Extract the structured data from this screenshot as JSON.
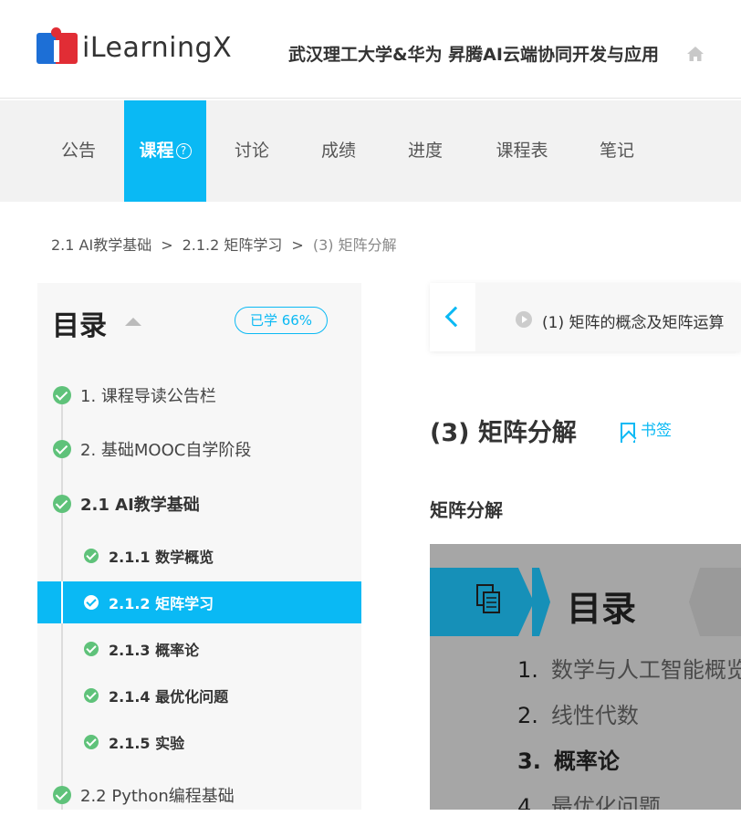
{
  "header": {
    "logo_text": "iLearningX",
    "course_title": "武汉理工大学&华为 昇腾AI云端协同开发与应用"
  },
  "nav": {
    "items": [
      {
        "label": "公告"
      },
      {
        "label": "课程",
        "help": "?"
      },
      {
        "label": "讨论"
      },
      {
        "label": "成绩"
      },
      {
        "label": "进度"
      },
      {
        "label": "课程表"
      },
      {
        "label": "笔记"
      }
    ]
  },
  "breadcrumb": [
    "2.1 AI教学基础",
    "2.1.2 矩阵学习",
    "(3) 矩阵分解"
  ],
  "breadcrumb_sep": ">",
  "sidebar": {
    "title": "目录",
    "progress": "已学 66%",
    "items": [
      {
        "label": "1. 课程导读公告栏"
      },
      {
        "label": "2. 基础MOOC自学阶段"
      },
      {
        "label": "2.1 AI教学基础"
      },
      {
        "label": "2.1.1 数学概览"
      },
      {
        "label": "2.1.2 矩阵学习"
      },
      {
        "label": "2.1.3 概率论"
      },
      {
        "label": "2.1.4 最优化问题"
      },
      {
        "label": "2.1.5 实验"
      },
      {
        "label": "2.2 Python编程基础"
      }
    ]
  },
  "main": {
    "prev_item": "(1) 矩阵的概念及矩阵运算",
    "page_title": "(3) 矩阵分解",
    "bookmark_label": "书签",
    "section_title": "矩阵分解",
    "slide": {
      "heading": "目录",
      "lines": [
        {
          "n": "1.",
          "text": "数学与人工智能概览"
        },
        {
          "n": "2.",
          "text": "线性代数"
        },
        {
          "n": "3.",
          "text": "概率论"
        },
        {
          "n": "4.",
          "text": "最优化问题"
        }
      ]
    }
  },
  "colors": {
    "accent": "#0ab9f4",
    "check": "#5fc27a"
  }
}
